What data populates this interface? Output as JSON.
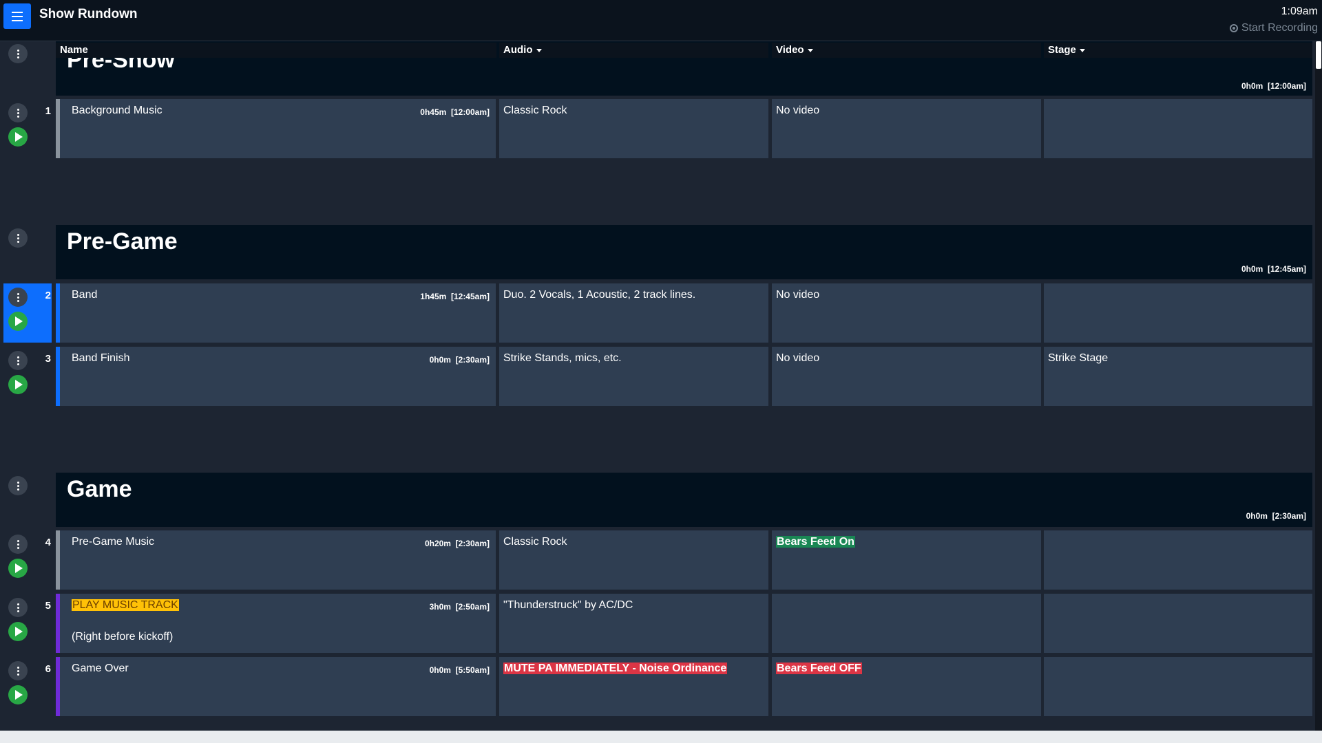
{
  "header": {
    "title": "Show Rundown",
    "clock": "1:09am",
    "record_label": "Start Recording"
  },
  "columns": {
    "name": "Name",
    "audio": "Audio",
    "video": "Video",
    "stage": "Stage"
  },
  "colors": {
    "accent": "#0d6efd",
    "play": "#28a745",
    "cell_bg": "#2f3e52",
    "section_bg": "#02111e",
    "stripe_gray": "#8a939d",
    "stripe_blue": "#0d6efd",
    "stripe_purple": "#6f2bd8",
    "warn": "#ffc107",
    "success": "#198754",
    "danger": "#dc3545"
  },
  "sections": [
    {
      "title": "Pre-Show",
      "duration": "0h0m",
      "time": "[12:00am]"
    },
    {
      "title": "Pre-Game",
      "duration": "0h0m",
      "time": "[12:45am]"
    },
    {
      "title": "Game",
      "duration": "0h0m",
      "time": "[2:30am]"
    }
  ],
  "rows": [
    {
      "num": "1",
      "name": "Background Music",
      "sub": "",
      "duration": "0h45m",
      "time": "[12:00am]",
      "audio": "Classic Rock",
      "video": "No video",
      "stage": ""
    },
    {
      "num": "2",
      "name": "Band",
      "sub": "",
      "duration": "1h45m",
      "time": "[12:45am]",
      "audio": "Duo. 2 Vocals, 1 Acoustic, 2 track lines.",
      "video": "No video",
      "stage": ""
    },
    {
      "num": "3",
      "name": "Band Finish",
      "sub": "",
      "duration": "0h0m",
      "time": "[2:30am]",
      "audio": "Strike Stands, mics, etc.",
      "video": "No video",
      "stage": "Strike Stage"
    },
    {
      "num": "4",
      "name": "Pre-Game Music",
      "sub": "",
      "duration": "0h20m",
      "time": "[2:30am]",
      "audio": "Classic Rock",
      "video": "Bears Feed On",
      "stage": ""
    },
    {
      "num": "5",
      "name": "PLAY MUSIC TRACK",
      "sub": "(Right before kickoff)",
      "duration": "3h0m",
      "time": "[2:50am]",
      "audio": "\"Thunderstruck\" by AC/DC",
      "video": "",
      "stage": ""
    },
    {
      "num": "6",
      "name": "Game Over",
      "sub": "",
      "duration": "0h0m",
      "time": "[5:50am]",
      "audio": "MUTE PA IMMEDIATELY - Noise Ordinance",
      "video": "Bears Feed OFF",
      "stage": ""
    }
  ]
}
